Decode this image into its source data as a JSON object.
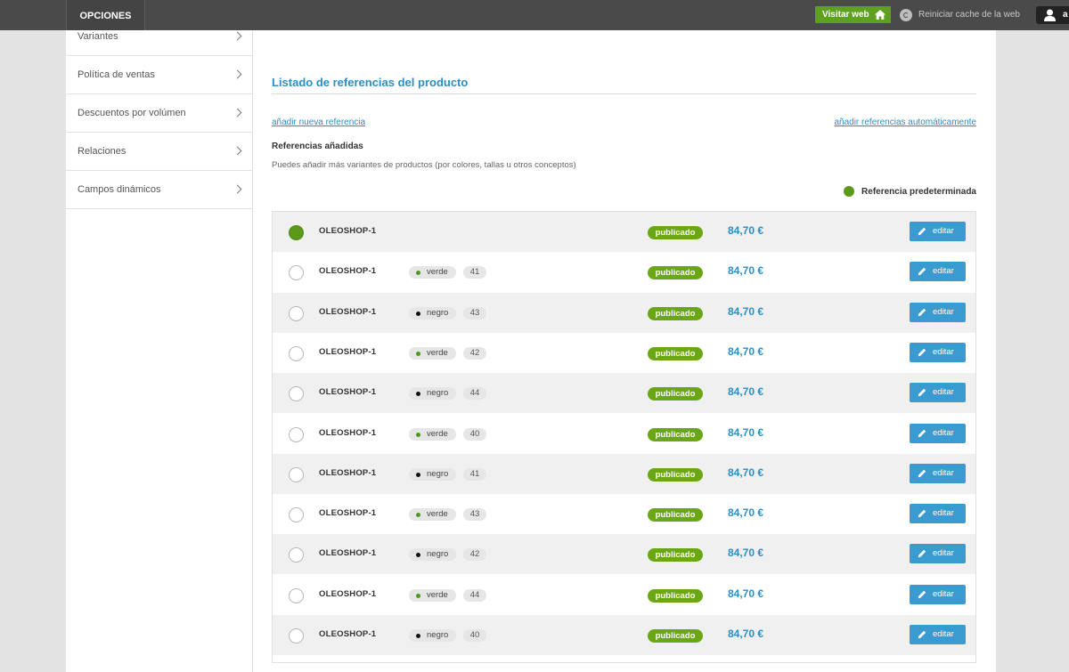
{
  "topbar": {
    "options_label": "OPCIONES",
    "visit_label": "Visitar web",
    "cache_label": "Reiniciar cache de la web",
    "user_label": "a"
  },
  "sidebar": {
    "items": [
      {
        "label": "Variantes"
      },
      {
        "label": "Política de ventas"
      },
      {
        "label": "Descuentos por volúmen"
      },
      {
        "label": "Relaciones"
      },
      {
        "label": "Campos dinámicos"
      }
    ]
  },
  "main": {
    "title": "Listado de referencias del producto",
    "link_new": "añadir nueva referencia",
    "link_auto": "añadir referencias automáticamente",
    "subtitle": "Referencias añadidas",
    "description": "Puedes añadir más variantes de productos (por colores, tallas u otros conceptos)",
    "legend": "Referencia predeterminada",
    "colors": {
      "verde": "#4a9a1c",
      "negro": "#111111",
      "accent": "#2a8fc4",
      "published": "#6ba714"
    }
  },
  "rows": [
    {
      "name": "OLEOSHOP-1",
      "color": "",
      "size": "",
      "status": "publicado",
      "price": "84,70 €",
      "edit": "editar",
      "default": true
    },
    {
      "name": "OLEOSHOP-1",
      "color": "verde",
      "size": "41",
      "status": "publicado",
      "price": "84,70 €",
      "edit": "editar",
      "default": false
    },
    {
      "name": "OLEOSHOP-1",
      "color": "negro",
      "size": "43",
      "status": "publicado",
      "price": "84,70 €",
      "edit": "editar",
      "default": false
    },
    {
      "name": "OLEOSHOP-1",
      "color": "verde",
      "size": "42",
      "status": "publicado",
      "price": "84,70 €",
      "edit": "editar",
      "default": false
    },
    {
      "name": "OLEOSHOP-1",
      "color": "negro",
      "size": "44",
      "status": "publicado",
      "price": "84,70 €",
      "edit": "editar",
      "default": false
    },
    {
      "name": "OLEOSHOP-1",
      "color": "verde",
      "size": "40",
      "status": "publicado",
      "price": "84,70 €",
      "edit": "editar",
      "default": false
    },
    {
      "name": "OLEOSHOP-1",
      "color": "negro",
      "size": "41",
      "status": "publicado",
      "price": "84,70 €",
      "edit": "editar",
      "default": false
    },
    {
      "name": "OLEOSHOP-1",
      "color": "verde",
      "size": "43",
      "status": "publicado",
      "price": "84,70 €",
      "edit": "editar",
      "default": false
    },
    {
      "name": "OLEOSHOP-1",
      "color": "negro",
      "size": "42",
      "status": "publicado",
      "price": "84,70 €",
      "edit": "editar",
      "default": false
    },
    {
      "name": "OLEOSHOP-1",
      "color": "verde",
      "size": "44",
      "status": "publicado",
      "price": "84,70 €",
      "edit": "editar",
      "default": false
    },
    {
      "name": "OLEOSHOP-1",
      "color": "negro",
      "size": "40",
      "status": "publicado",
      "price": "84,70 €",
      "edit": "editar",
      "default": false
    }
  ]
}
